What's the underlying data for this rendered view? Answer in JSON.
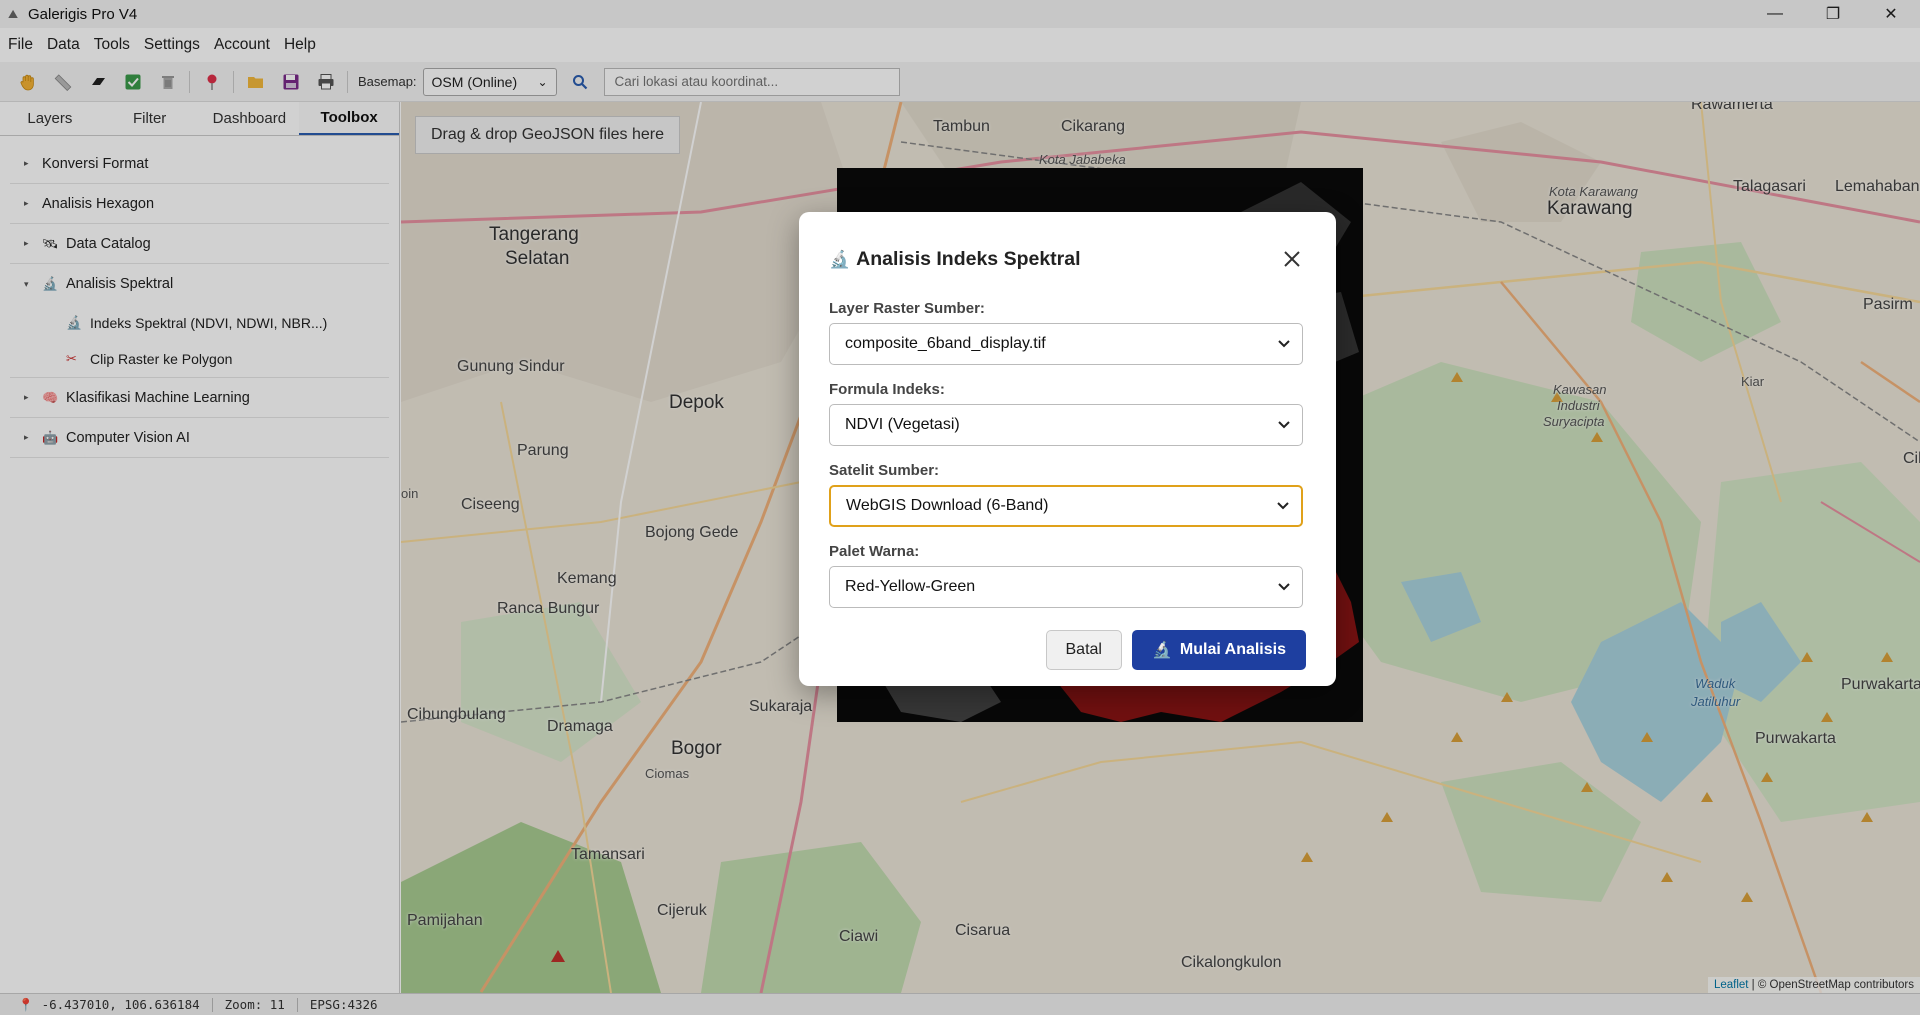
{
  "window": {
    "title": "Galerigis Pro V4",
    "controls": [
      "—",
      "❐",
      "✕"
    ]
  },
  "menubar": {
    "items": [
      "File",
      "Data",
      "Tools",
      "Settings",
      "Account",
      "Help"
    ]
  },
  "toolbar": {
    "basemap_label": "Basemap:",
    "basemap_value": "OSM (Online)",
    "search_placeholder": "Cari lokasi atau koordinat...",
    "icons": [
      "pan-hand-icon",
      "ruler-icon",
      "eraser-icon",
      "checkbox-icon",
      "trash-icon",
      "marker-pin-icon",
      "folder-open-icon",
      "save-icon",
      "print-icon",
      "search-icon"
    ]
  },
  "sidebar": {
    "tabs": [
      "Layers",
      "Filter",
      "Dashboard",
      "Toolbox"
    ],
    "active_tab": "Toolbox",
    "tree": [
      {
        "label": "Konversi Format",
        "icon": "",
        "expanded": false
      },
      {
        "label": "Analisis Hexagon",
        "icon": "",
        "expanded": false
      },
      {
        "label": "Data Catalog",
        "icon": "🛰",
        "expanded": false
      },
      {
        "label": "Analisis Spektral",
        "icon": "🔬",
        "expanded": true,
        "children": [
          {
            "label": "Indeks Spektral (NDVI, NDWI, NBR...)",
            "icon": "🔬"
          },
          {
            "label": "Clip Raster ke Polygon",
            "icon": "✂"
          }
        ]
      },
      {
        "label": "Klasifikasi Machine Learning",
        "icon": "🧠",
        "expanded": false
      },
      {
        "label": "Computer Vision AI",
        "icon": "🤖",
        "expanded": false
      }
    ]
  },
  "map": {
    "drop_hint": "Drag & drop GeoJSON files here",
    "attribution_leaflet": "Leaflet",
    "attribution_rest": " | © OpenStreetMap contributors",
    "places": [
      "Tambun",
      "Cikarang",
      "Kota Jababeka",
      "Rawamerta",
      "Tangerang",
      "Selatan",
      "Karawang",
      "Talagasari",
      "Lemahabang",
      "Kota Karawang",
      "Gunung Sindur",
      "Depok",
      "Pasirm",
      "Kawasan",
      "Industri",
      "Suryacipta",
      "Parung",
      "Ciseeng",
      "Bojong Gede",
      "Kemang",
      "Ranca Bungur",
      "Cibungbulang",
      "Dramaga",
      "Bogor",
      "Sukaraja",
      "Ciomas",
      "Tamansari",
      "Pamijahan",
      "Cijeruk",
      "Ciawi",
      "Cisarua",
      "Cikalongkulon",
      "Purwakarta",
      "Waduk",
      "Jatiluhur",
      "Purwakarta",
      "Cil",
      "Kiar",
      "oin"
    ]
  },
  "status": {
    "coords": "-6.437010, 106.636184",
    "zoom": "Zoom: 11",
    "crs": "EPSG:4326"
  },
  "modal": {
    "title": "Analisis Indeks Spektral",
    "title_icon": "🔬",
    "fields": [
      {
        "label": "Layer Raster Sumber:",
        "value": "composite_6band_display.tif"
      },
      {
        "label": "Formula Indeks:",
        "value": "NDVI (Vegetasi)"
      },
      {
        "label": "Satelit Sumber:",
        "value": "WebGIS Download (6-Band)",
        "focused": true
      },
      {
        "label": "Palet Warna:",
        "value": "Red-Yellow-Green"
      }
    ],
    "cancel_label": "Batal",
    "start_label": "Mulai Analisis",
    "start_icon": "🔬"
  },
  "colors": {
    "accent": "#1e3fa0",
    "focus": "#e0a11a",
    "raster_red": "#8a1414",
    "raster_bg": "#0a0a0a"
  }
}
